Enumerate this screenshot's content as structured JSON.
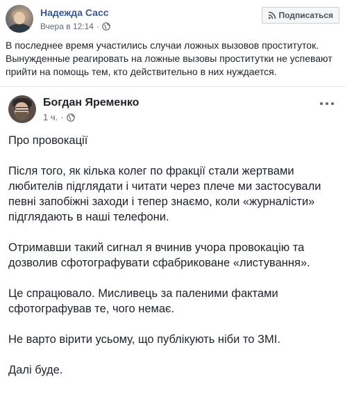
{
  "outer_post": {
    "author": "Надежда Сасс",
    "timestamp": "Вчера в 12:14",
    "privacy_icon": "globe-icon",
    "subscribe_label": "Подписаться",
    "subscribe_icon": "rss-icon",
    "text": "В последнее время участились случаи ложных вызовов проституток. Вынужденные реагировать на ложные вызовы проститутки не успевают прийти на помощь тем, кто действительно в них нуждается."
  },
  "shared_post": {
    "author": "Богдан Яременко",
    "timestamp": "1 ч.",
    "privacy_icon": "globe-icon",
    "menu_icon": "more-options-icon",
    "paragraphs": [
      "Про провокації",
      "Після того, як кілька колег по фракції стали жертвами любителів підглядати і читати через плече ми застосували певні запобіжні заходи і тепер знаємо, коли «журналісти» підглядають в наші телефони.",
      "Отримавши такий сигнал я вчинив учора провокацію та дозволив сфотографувати сфабриковане  «листування».",
      "Це спрацювало. Мисливець за паленими фактами сфотографував те, чого немає.",
      "Не варто вірити усьому, що публікують ніби то ЗМІ.",
      "Далі буде."
    ]
  },
  "colors": {
    "link_blue": "#385898",
    "meta_gray": "#606770",
    "text": "#1d2129",
    "divider": "#dddfe2"
  }
}
